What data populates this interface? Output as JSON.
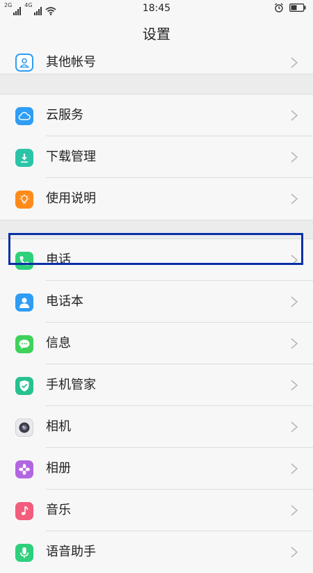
{
  "status_bar": {
    "time": "18:45",
    "signal_1_label": "2G",
    "signal_2_label": "4G"
  },
  "header": {
    "title": "设置"
  },
  "sections": [
    {
      "items": [
        {
          "label": "其他帐号",
          "icon": "user-account-icon",
          "icon_color": "#2f9df5"
        }
      ]
    },
    {
      "items": [
        {
          "label": "云服务",
          "icon": "cloud-icon",
          "icon_color": "#2f9df5"
        },
        {
          "label": "下载管理",
          "icon": "download-icon",
          "icon_color": "#2cc4a7"
        },
        {
          "label": "使用说明",
          "icon": "lightbulb-icon",
          "icon_color": "#ff8a1a"
        }
      ]
    },
    {
      "items": [
        {
          "label": "电话",
          "icon": "phone-icon",
          "icon_color": "#2dd179"
        },
        {
          "label": "电话本",
          "icon": "contacts-icon",
          "icon_color": "#2f9df5"
        },
        {
          "label": "信息",
          "icon": "message-icon",
          "icon_color": "#3fd25a"
        },
        {
          "label": "手机管家",
          "icon": "shield-icon",
          "icon_color": "#25c290"
        },
        {
          "label": "相机",
          "icon": "camera-icon",
          "icon_color": "#6a6a72"
        },
        {
          "label": "相册",
          "icon": "gallery-icon",
          "icon_color": "#b266e0"
        },
        {
          "label": "音乐",
          "icon": "music-icon",
          "icon_color": "#f25d7b"
        },
        {
          "label": "语音助手",
          "icon": "microphone-icon",
          "icon_color": "#2ed07d"
        }
      ]
    }
  ],
  "colors": {
    "highlight_border": "#0a2fa8",
    "background": "#f3f3f3"
  }
}
